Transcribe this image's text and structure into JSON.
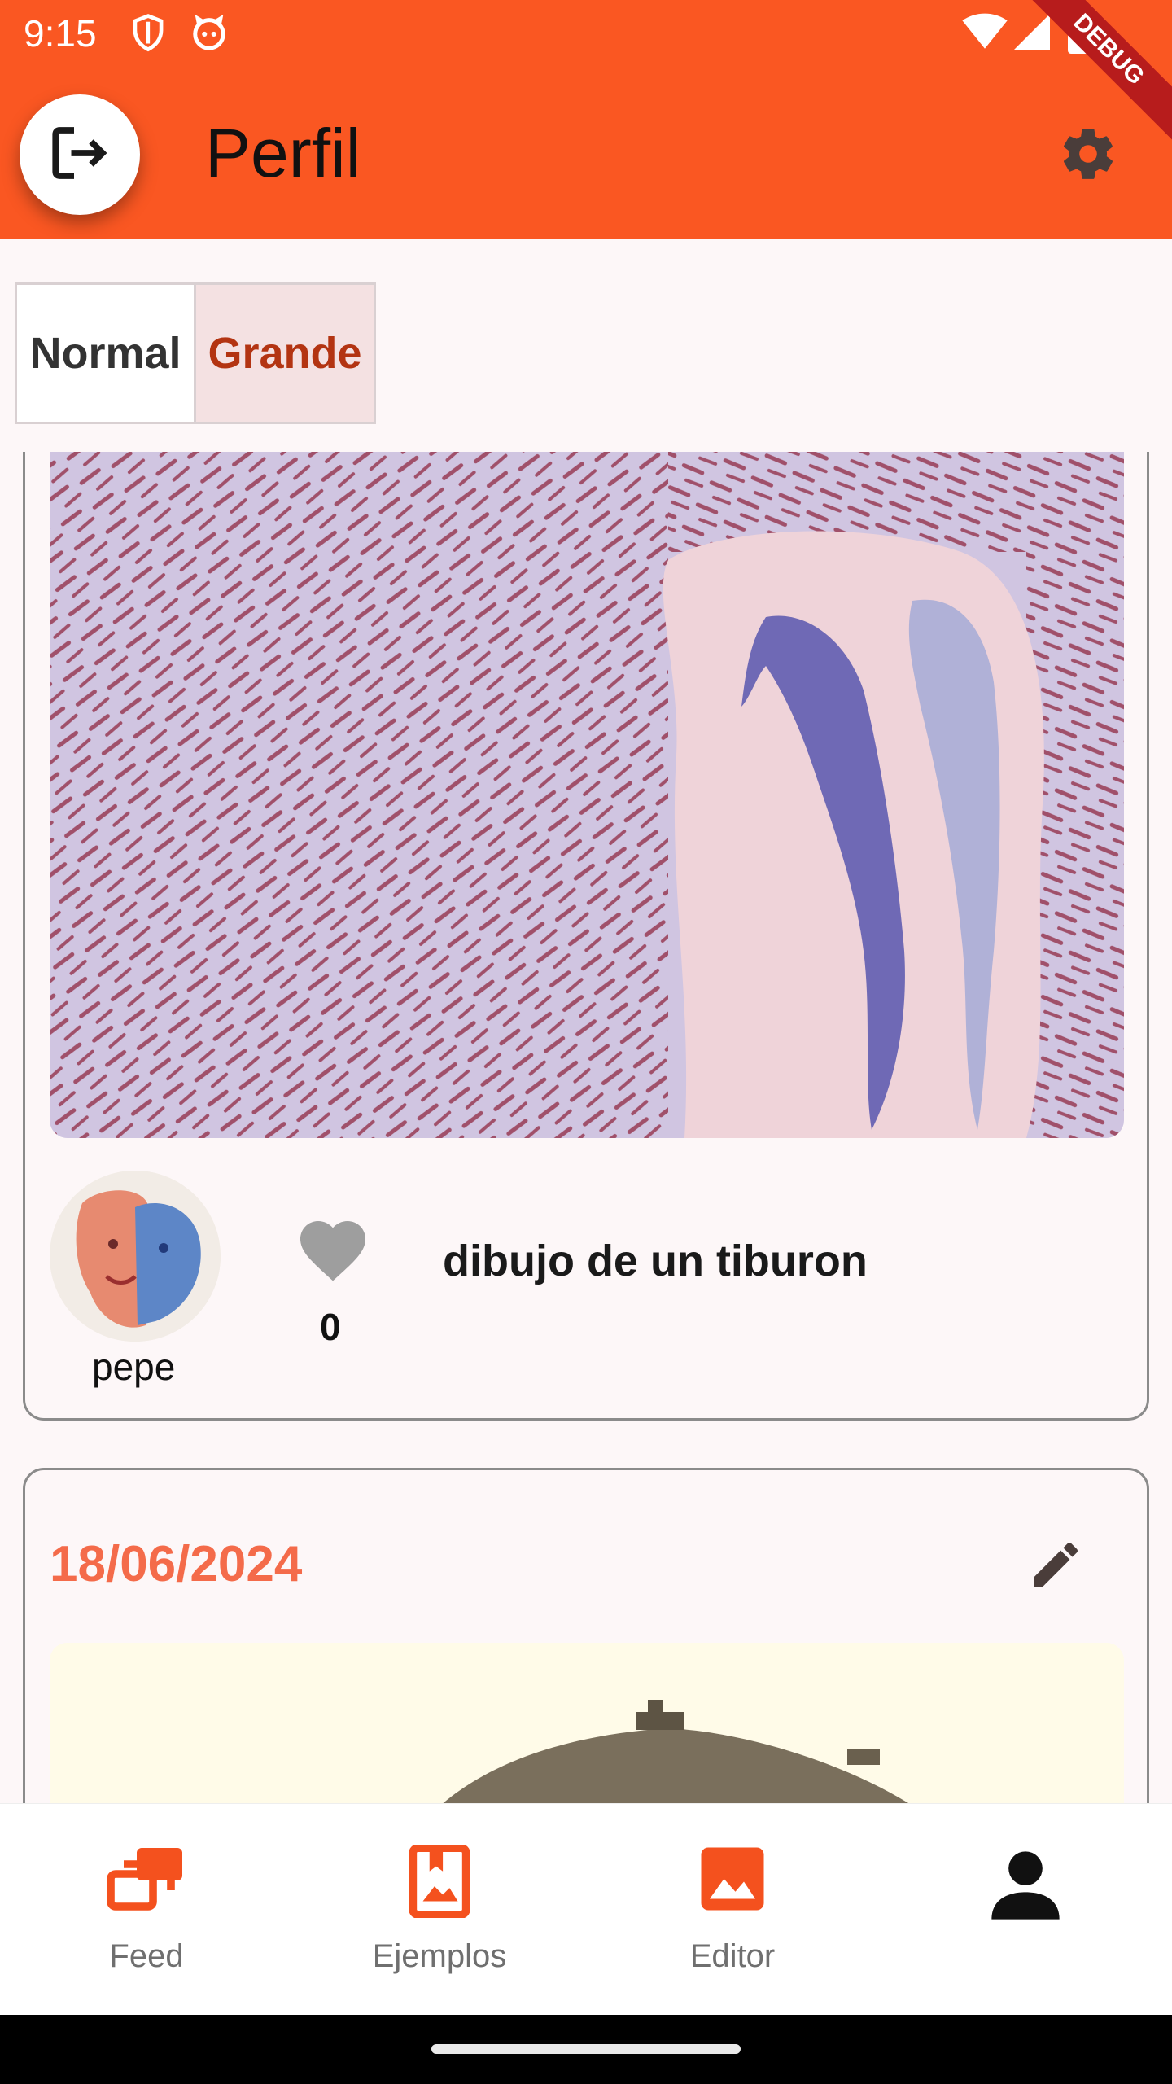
{
  "status_bar": {
    "time": "9:15",
    "debug_banner": "DEBUG"
  },
  "app_bar": {
    "title": "Perfil"
  },
  "view_toggle": {
    "options": [
      "Normal",
      "Grande"
    ],
    "selected": "Grande"
  },
  "posts": [
    {
      "username": "pepe",
      "likes": "0",
      "caption": "dibujo de un tiburon"
    },
    {
      "date": "18/06/2024"
    }
  ],
  "bottom_nav": {
    "items": [
      {
        "label": "Feed",
        "icon": "collections-icon"
      },
      {
        "label": "Ejemplos",
        "icon": "bookmark-image-icon"
      },
      {
        "label": "Editor",
        "icon": "image-icon"
      },
      {
        "label": "",
        "icon": "person-icon"
      }
    ],
    "active_index": 3
  },
  "colors": {
    "primary": "#fa5722",
    "accent": "#f46b4a",
    "selected_text": "#b33412",
    "selected_bg": "#f4e1e2"
  }
}
